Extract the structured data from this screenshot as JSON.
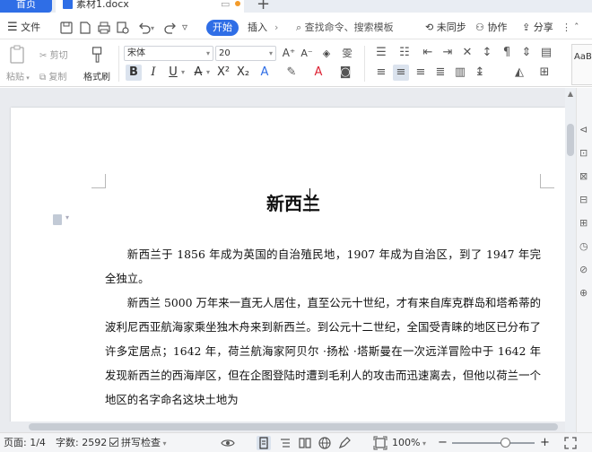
{
  "tabs": {
    "home_label": "首页",
    "doc_label": "素材1.docx",
    "new_tab": "+"
  },
  "menu": {
    "file_label": "文件",
    "start_label": "开始",
    "insert_label": "插入",
    "search_placeholder": "查找命令、搜索模板",
    "unsynced_label": "未同步",
    "collab_label": "协作",
    "share_label": "分享"
  },
  "ribbon": {
    "paste_label": "粘贴",
    "cut_label": "剪切",
    "copy_label": "复制",
    "format_painter_label": "格式刷",
    "font_name": "宋体",
    "font_size": "20",
    "style_preview": "AaBb"
  },
  "document": {
    "title": "新西兰",
    "paragraphs": [
      "新西兰于 1856 年成为英国的自治殖民地，1907 年成为自治区，到了 1947 年完全独立。",
      "新西兰 5000 万年来一直无人居住，直至公元十世纪，才有来自库克群岛和塔希蒂的波利尼西亚航海家乘坐独木舟来到新西兰。到公元十二世纪，全国受青睐的地区已分布了许多定居点；1642 年，荷兰航海家阿贝尔 ·扬松 ·塔斯曼在一次远洋冒险中于 1642 年发现新西兰的西海岸区，但在企图登陆时遭到毛利人的攻击而迅速离去，但他以荷兰一个地区的名字命名这块土地为"
    ]
  },
  "status": {
    "page": "页面: 1/4",
    "word_count": "字数: 2592",
    "spell_check": "拼写检查",
    "zoom": "100%"
  },
  "colors": {
    "accent": "#2f6ee6",
    "background": "#e9ebef"
  }
}
